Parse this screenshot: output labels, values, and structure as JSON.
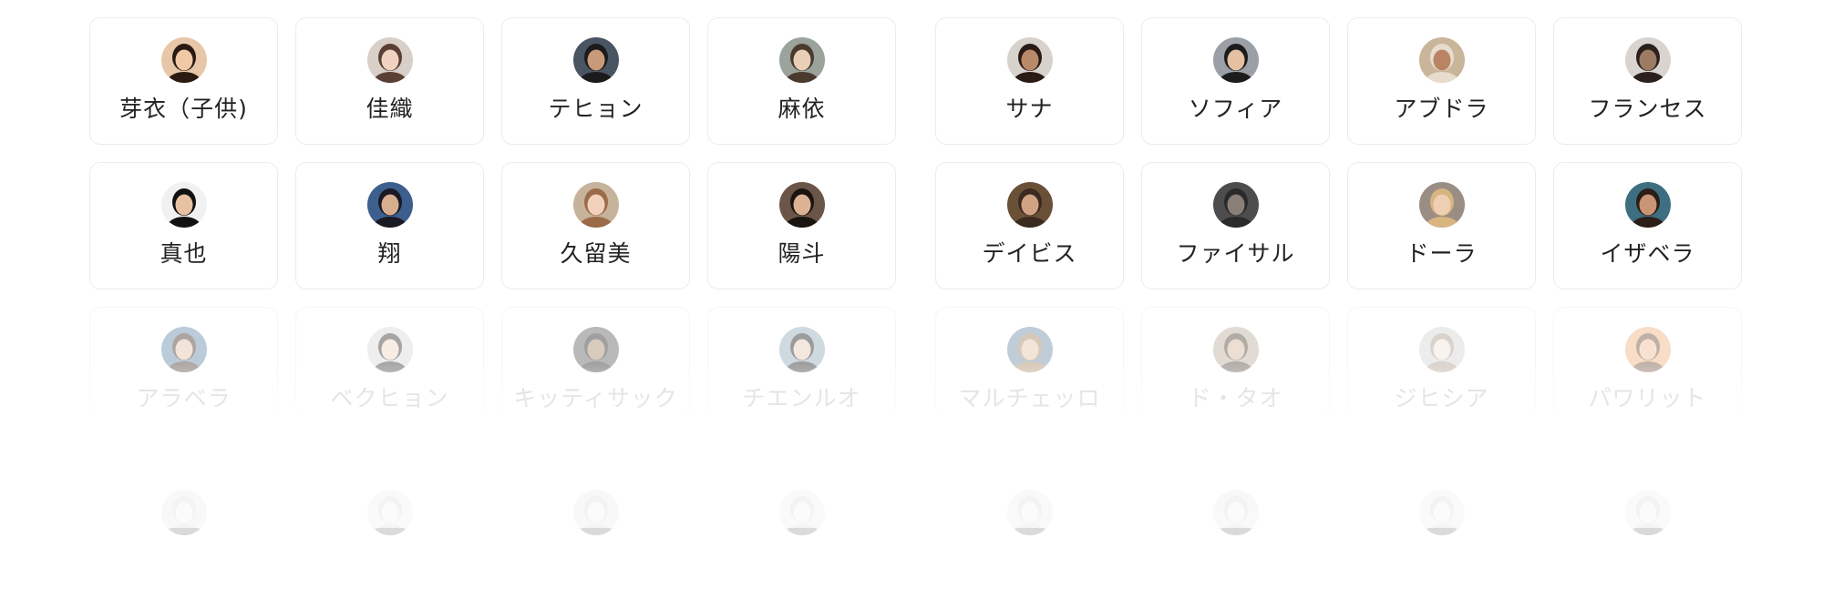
{
  "rows": [
    {
      "items": [
        {
          "name": "芽衣（子供)",
          "avatar_icon": "portrait-girl-icon",
          "skin": "#f2c9a6",
          "hair": "#2a1a12",
          "bg": "#e8c7a8"
        },
        {
          "name": "佳織",
          "avatar_icon": "portrait-woman-icon",
          "skin": "#efd2bf",
          "hair": "#5a4034",
          "bg": "#d8cfc8"
        },
        {
          "name": "テヒョン",
          "avatar_icon": "portrait-man-icon",
          "skin": "#c99a7a",
          "hair": "#1b1b1b",
          "bg": "#4a5563"
        },
        {
          "name": "麻依",
          "avatar_icon": "portrait-woman-icon",
          "skin": "#e9ceb8",
          "hair": "#4a3a2e",
          "bg": "#9aa39c"
        }
      ]
    },
    {
      "items": [
        {
          "name": "真也",
          "avatar_icon": "portrait-man-icon",
          "skin": "#e7c2a2",
          "hair": "#111111",
          "bg": "#f1f1f1"
        },
        {
          "name": "翔",
          "avatar_icon": "portrait-man-icon",
          "skin": "#d9ae8f",
          "hair": "#1a1a24",
          "bg": "#3c5f8d"
        },
        {
          "name": "久留美",
          "avatar_icon": "portrait-woman-icon",
          "skin": "#f1d1bb",
          "hair": "#9b6a48",
          "bg": "#c7b39b"
        },
        {
          "name": "陽斗",
          "avatar_icon": "portrait-man-icon",
          "skin": "#dcb295",
          "hair": "#1a1410",
          "bg": "#6b5548"
        }
      ]
    },
    {
      "items": [
        {
          "name": "アラベラ",
          "avatar_icon": "portrait-woman-icon",
          "skin": "#e3c0a6",
          "hair": "#3b2b22",
          "bg": "#5e84a8"
        },
        {
          "name": "ベクヒョン",
          "avatar_icon": "portrait-man-icon",
          "skin": "#efd5c2",
          "hair": "#2a2a2a",
          "bg": "#d8d8d8"
        },
        {
          "name": "キッティサック",
          "avatar_icon": "portrait-man-icon",
          "skin": "#a88468",
          "hair": "#1e1e1e",
          "bg": "#5b5b5b"
        },
        {
          "name": "チエンルオ",
          "avatar_icon": "portrait-woman-icon",
          "skin": "#e6c7b1",
          "hair": "#151515",
          "bg": "#8fa7b6"
        }
      ]
    },
    {
      "items": [
        {
          "name": "",
          "avatar_icon": "portrait-icon",
          "skin": "#d9d9d9",
          "hair": "#888888",
          "bg": "#bdbdbd"
        },
        {
          "name": "",
          "avatar_icon": "portrait-icon",
          "skin": "#d9d9d9",
          "hair": "#888888",
          "bg": "#c8c8c8"
        },
        {
          "name": "",
          "avatar_icon": "portrait-icon",
          "skin": "#d9d9d9",
          "hair": "#888888",
          "bg": "#bdbdbd"
        },
        {
          "name": "",
          "avatar_icon": "portrait-icon",
          "skin": "#d9d9d9",
          "hair": "#888888",
          "bg": "#cfcfcf"
        }
      ]
    }
  ],
  "rows_right": [
    {
      "items": [
        {
          "name": "サナ",
          "avatar_icon": "portrait-woman-icon",
          "skin": "#b98a6a",
          "hair": "#2a1c15",
          "bg": "#d7d2cc"
        },
        {
          "name": "ソフィア",
          "avatar_icon": "portrait-woman-hijab-icon",
          "skin": "#e5c0a3",
          "hair": "#1c1c1c",
          "bg": "#9aa0a6"
        },
        {
          "name": "アブドラ",
          "avatar_icon": "portrait-man-icon",
          "skin": "#b88464",
          "hair": "#e7dccd",
          "bg": "#c9b59a"
        },
        {
          "name": "フランセス",
          "avatar_icon": "portrait-woman-icon",
          "skin": "#9d7a62",
          "hair": "#2a211c",
          "bg": "#d9d4cf"
        }
      ]
    },
    {
      "items": [
        {
          "name": "デイビス",
          "avatar_icon": "portrait-man-glasses-icon",
          "skin": "#d2a382",
          "hair": "#3a2a1f",
          "bg": "#6b5038"
        },
        {
          "name": "ファイサル",
          "avatar_icon": "portrait-man-icon",
          "skin": "#8a7e78",
          "hair": "#2a2a2a",
          "bg": "#4d4d4d"
        },
        {
          "name": "ドーラ",
          "avatar_icon": "portrait-woman-icon",
          "skin": "#efcfb3",
          "hair": "#d8b47f",
          "bg": "#9a8e84"
        },
        {
          "name": "イザベラ",
          "avatar_icon": "portrait-woman-icon",
          "skin": "#c99575",
          "hair": "#2b1d17",
          "bg": "#3d6f80"
        }
      ]
    },
    {
      "items": [
        {
          "name": "マルチェッロ",
          "avatar_icon": "portrait-man-icon",
          "skin": "#e4c0a4",
          "hair": "#a17f58",
          "bg": "#6b8aa6"
        },
        {
          "name": "ド・タオ",
          "avatar_icon": "portrait-man-icon",
          "skin": "#d6b198",
          "hair": "#4a3b30",
          "bg": "#b8aa98"
        },
        {
          "name": "ジヒシア",
          "avatar_icon": "portrait-woman-icon",
          "skin": "#eee3da",
          "hair": "#a99585",
          "bg": "#d2d2d2"
        },
        {
          "name": "パワリット",
          "avatar_icon": "portrait-man-icon",
          "skin": "#f1b996",
          "hair": "#6a4733",
          "bg": "#f0b07c"
        }
      ]
    },
    {
      "items": [
        {
          "name": "",
          "avatar_icon": "portrait-icon",
          "skin": "#d9d9d9",
          "hair": "#888888",
          "bg": "#c3c3c3"
        },
        {
          "name": "",
          "avatar_icon": "portrait-icon",
          "skin": "#d9d9d9",
          "hair": "#888888",
          "bg": "#bfbfbf"
        },
        {
          "name": "",
          "avatar_icon": "portrait-icon",
          "skin": "#d9d9d9",
          "hair": "#888888",
          "bg": "#cfcfcf"
        },
        {
          "name": "",
          "avatar_icon": "portrait-icon",
          "skin": "#d9d9d9",
          "hair": "#888888",
          "bg": "#d0d0d0"
        }
      ]
    }
  ]
}
